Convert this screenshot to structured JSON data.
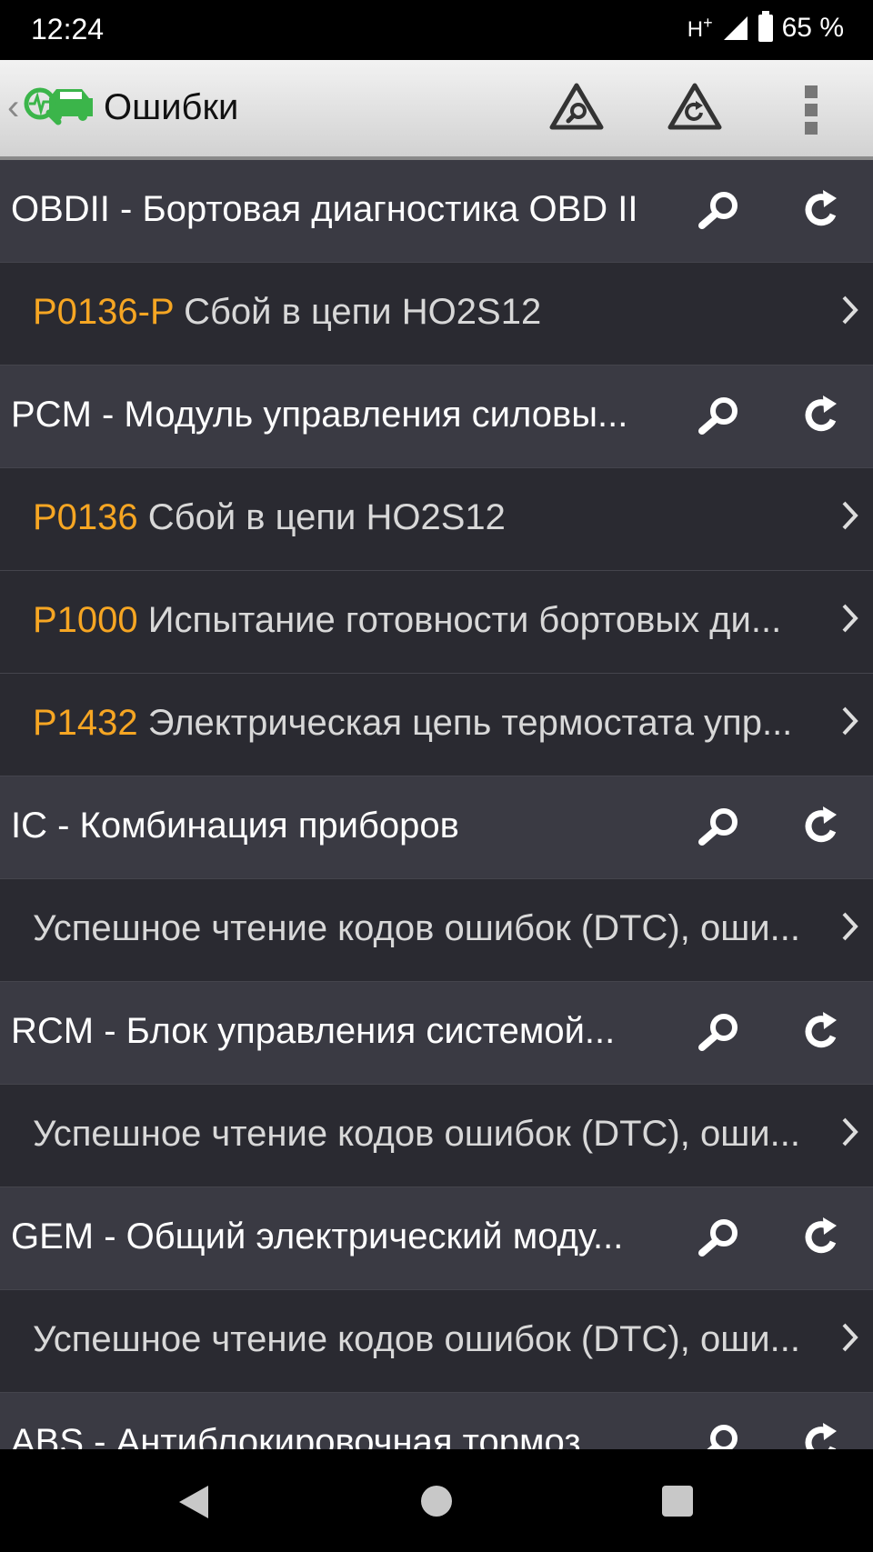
{
  "status_bar": {
    "time": "12:24",
    "network": "H",
    "network_plus": "+",
    "battery": "65 %"
  },
  "app_bar": {
    "title": "Ошибки",
    "icons": [
      "back-chevron-icon",
      "car-diagnostic-logo-icon",
      "scan-search-icon",
      "clear-refresh-icon",
      "more-vertical-icon"
    ]
  },
  "list": {
    "rows": [
      {
        "type": "module",
        "name": "OBDII - Бортовая диагностика OBD II"
      },
      {
        "type": "dtc",
        "code": "P0136-P",
        "description": "Сбой в цепи HO2S12"
      },
      {
        "type": "module",
        "name": "PCM - Модуль управления силовы..."
      },
      {
        "type": "dtc",
        "code": "P0136",
        "description": "Сбой в цепи HO2S12"
      },
      {
        "type": "dtc",
        "code": "P1000",
        "description": "Испытание готовности бортовых ди..."
      },
      {
        "type": "dtc",
        "code": "P1432",
        "description": "Электрическая цепь термостата упр..."
      },
      {
        "type": "module",
        "name": "IC - Комбинация приборов"
      },
      {
        "type": "dtc",
        "code": "",
        "description": "Успешное чтение кодов ошибок (DTC), оши..."
      },
      {
        "type": "module",
        "name": "RCM - Блок управления системой..."
      },
      {
        "type": "dtc",
        "code": "",
        "description": "Успешное чтение кодов ошибок (DTC), оши..."
      },
      {
        "type": "module",
        "name": "GEM - Общий электрический моду..."
      },
      {
        "type": "dtc",
        "code": "",
        "description": "Успешное чтение кодов ошибок (DTC), оши..."
      },
      {
        "type": "module",
        "name": "ABS - Антиблокировочная тормоз..."
      }
    ]
  },
  "nav_bar": {
    "icons": [
      "back-triangle-icon",
      "home-circle-icon",
      "recents-square-icon"
    ]
  },
  "colors": {
    "accent_code": "#f6a623",
    "list_bg": "#2b2b33",
    "module_bg": "#3a3a43",
    "logo_green": "#3bb54a"
  }
}
